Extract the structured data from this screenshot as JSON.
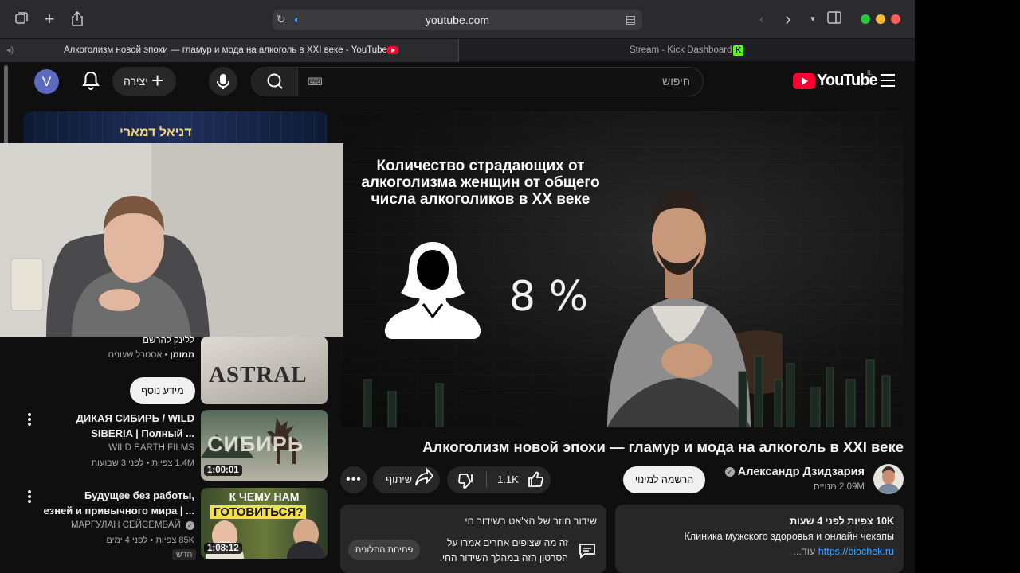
{
  "browser": {
    "url": "youtube.com",
    "tabs": [
      {
        "title": "Алкоголизм новой эпохи — гламур и мода на алкоголь в XXI веке - YouTube",
        "active": true
      },
      {
        "title": "Stream - Kick Dashboard",
        "active": false
      }
    ],
    "traffic_colors": [
      "#28c840",
      "#febc2e",
      "#ff5f57"
    ]
  },
  "masthead": {
    "avatar_letter": "V",
    "create_label": "יצירה",
    "search_placeholder": "חיפוש",
    "logo_text": "YouTube",
    "logo_country": "IL"
  },
  "player": {
    "overlay_title": "Количество страдающих от алкоголизма женщин от общего числа алкоголиков в XX веке",
    "percent": "8 %"
  },
  "ad": {
    "banner_text": "דניאל דמארי"
  },
  "related": [
    {
      "title": "",
      "channel_line": "ללינק להרשם",
      "meta_prefix": "ממומן",
      "meta": "אסטרל שעונים",
      "thumb_text": "ASTRAL",
      "button": "מידע נוסף"
    },
    {
      "title_1": "ДИКАЯ СИБИРЬ / WILD",
      "title_2": "SIBERIA | Полный ...",
      "channel": "WILD EARTH FILMS",
      "meta": "1.4M צפיות • לפני 3 שבועות",
      "duration": "1:00:01",
      "thumb_text": "СИБИРЬ"
    },
    {
      "title_1": "Будущее без работы,",
      "title_2": "езней и привычного мира | ...",
      "channel": "МАРГУЛАН СЕЙСЕМБАЙ",
      "meta": "85K צפיות • לפני 4 ימים",
      "duration": "1:08:12",
      "thumb_text_1": "К ЧЕМУ НАМ",
      "thumb_text_2": "ГОТОВИТЬСЯ?",
      "badge": "חדש"
    }
  ],
  "video": {
    "title": "Алкоголизм новой эпохи — гламур и мода на алкоголь в XXI веке",
    "owner": "Александр Дзидзария",
    "subs": "2.09M מנויים",
    "subscribe": "הרשמה למינוי",
    "likes": "1.1K",
    "share": "שיתוף",
    "more": "•••"
  },
  "description": {
    "stats": "10K צפיות  לפני 4 שעות",
    "line1": "Клиника мужского здоровья  и онлайн чекапы",
    "link": "https://biochek.ru",
    "more": "...עוד"
  },
  "live_chat": {
    "heading": "שידור חוזר של הצ'אט בשידור חי",
    "line1": "זה מה שצופים אחרים אמרו על",
    "line2": "הסרטון הזה במהלך השידור החי.",
    "button": "פתיחת התלונית"
  }
}
